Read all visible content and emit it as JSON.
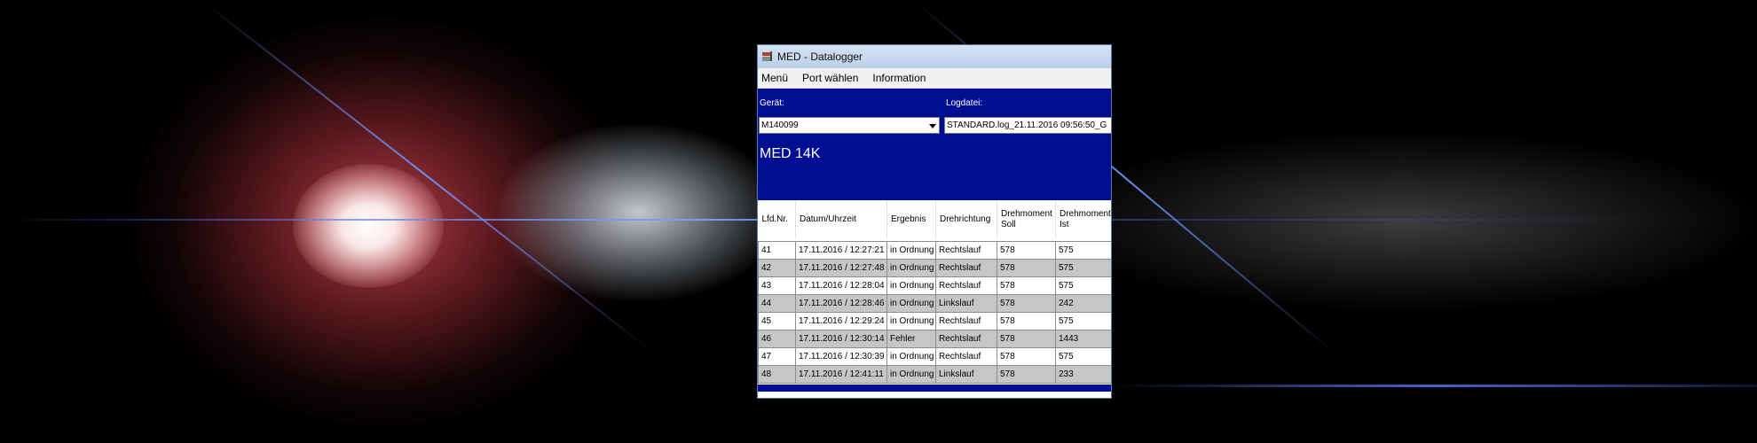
{
  "window": {
    "title": "MED - Datalogger"
  },
  "menu": [
    "Menü",
    "Port wählen",
    "Information"
  ],
  "form": {
    "device_label": "Gerät:",
    "device_value": "M140099",
    "logfile_label": "Logdatei:",
    "logfile_value": "STANDARD.log_21.11.2016 09:56:50_G"
  },
  "model_title": "MED 14K",
  "table": {
    "headers": [
      "Lfd.Nr.",
      "Datum/Uhrzeit",
      "Ergebnis",
      "Drehrichtung",
      "Drehmoment Soll",
      "Drehmoment Ist"
    ],
    "rows": [
      [
        "41",
        "17.11.2016 / 12:27:21",
        "in Ordnung",
        "Rechtslauf",
        "578",
        "575"
      ],
      [
        "42",
        "17.11.2016 / 12:27:48",
        "in Ordnung",
        "Rechtslauf",
        "578",
        "575"
      ],
      [
        "43",
        "17.11.2016 / 12:28:04",
        "in Ordnung",
        "Rechtslauf",
        "578",
        "575"
      ],
      [
        "44",
        "17.11.2016 / 12:28:46",
        "in Ordnung",
        "Linkslauf",
        "578",
        "242"
      ],
      [
        "45",
        "17.11.2016 / 12:29:24",
        "in Ordnung",
        "Rechtslauf",
        "578",
        "575"
      ],
      [
        "46",
        "17.11.2016 / 12:30:14",
        "Fehler",
        "Rechtslauf",
        "578",
        "1443"
      ],
      [
        "47",
        "17.11.2016 / 12:30:39",
        "in Ordnung",
        "Rechtslauf",
        "578",
        " 575"
      ],
      [
        "48",
        "17.11.2016 / 12:41:11",
        "in Ordnung",
        "Linkslauf",
        "578",
        "233"
      ]
    ]
  },
  "colors": {
    "panel_blue": "#000e94",
    "row_alt_gray": "#c6c6c6"
  },
  "icons": [
    "app-icon",
    "chevron-down-icon"
  ]
}
